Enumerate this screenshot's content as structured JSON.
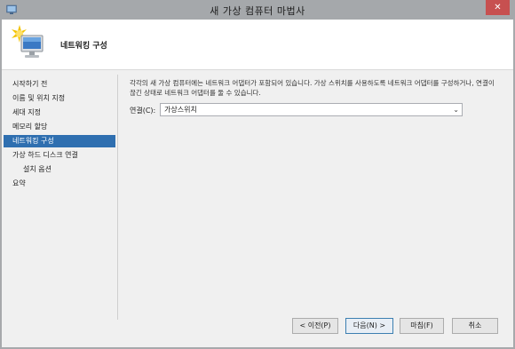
{
  "window": {
    "title": "새 가상 컴퓨터 마법사",
    "close_glyph": "✕"
  },
  "header": {
    "title": "네트워킹 구성"
  },
  "nav": {
    "items": [
      {
        "label": "시작하기 전",
        "active": false,
        "sub": false
      },
      {
        "label": "이름 및 위치 지정",
        "active": false,
        "sub": false
      },
      {
        "label": "세대 지정",
        "active": false,
        "sub": false
      },
      {
        "label": "메모리 할당",
        "active": false,
        "sub": false
      },
      {
        "label": "네트워킹 구성",
        "active": true,
        "sub": false
      },
      {
        "label": "가상 하드 디스크 연결",
        "active": false,
        "sub": false
      },
      {
        "label": "설치 옵션",
        "active": false,
        "sub": true
      },
      {
        "label": "요약",
        "active": false,
        "sub": false
      }
    ]
  },
  "main": {
    "description": "각각의 새 가상 컴퓨터에는 네트워크 어댑터가 포함되어 있습니다. 가상 스위치를 사용하도록 네트워크 어댑터를 구성하거나, 연결이 끊긴 상태로 네트워크 어댑터를 둘 수 있습니다.",
    "connection_label": "연결(C):",
    "connection_value": "가상스위치",
    "dropdown_arrow": "⌄"
  },
  "buttons": {
    "prev": "< 이전(P)",
    "next": "다음(N) >",
    "finish": "마침(F)",
    "cancel": "취소"
  },
  "colors": {
    "selection": "#2f6fb0",
    "close": "#c75050"
  }
}
